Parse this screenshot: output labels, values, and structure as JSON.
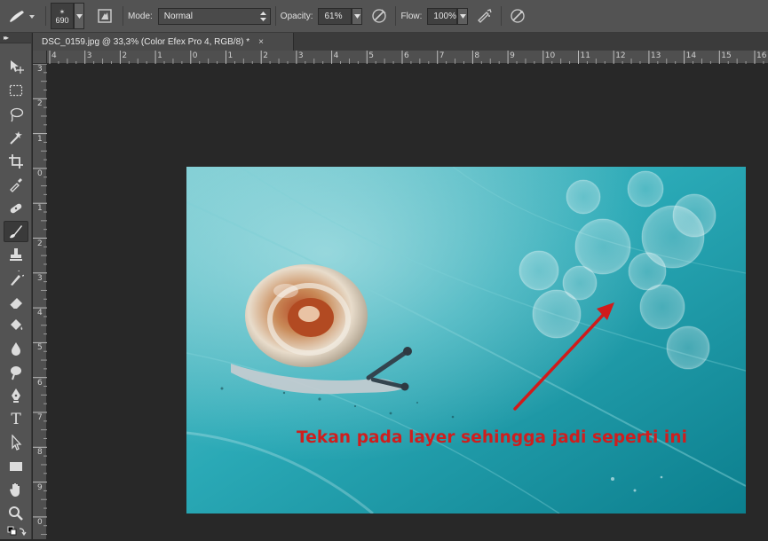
{
  "options_bar": {
    "brush_size": "690",
    "mode_label": "Mode:",
    "mode_value": "Normal",
    "opacity_label": "Opacity:",
    "opacity_value": "61%",
    "flow_label": "Flow:",
    "flow_value": "100%"
  },
  "document_tab": {
    "title": "DSC_0159.jpg @ 33,3% (Color Efex Pro 4, RGB/8) *",
    "close": "×"
  },
  "ruler_h": [
    "4",
    "3",
    "2",
    "1",
    "0",
    "1",
    "2",
    "3",
    "4",
    "5",
    "6",
    "7",
    "8",
    "9",
    "10",
    "11",
    "12",
    "13",
    "14",
    "15",
    "16"
  ],
  "ruler_v": [
    "3",
    "2",
    "1",
    "0",
    "1",
    "2",
    "3",
    "4",
    "5",
    "6",
    "7",
    "8",
    "9",
    "0"
  ],
  "annotation": {
    "text": "Tekan pada layer sehingga jadi seperti ini",
    "color": "#cf1e1e"
  },
  "toolbar": {
    "tools": [
      "move-tool",
      "marquee-tool",
      "lasso-tool",
      "magic-wand-tool",
      "crop-tool",
      "eyedropper-tool",
      "healing-brush-tool",
      "brush-tool",
      "clone-stamp-tool",
      "history-brush-tool",
      "eraser-tool",
      "paint-bucket-tool",
      "blur-tool",
      "dodge-tool",
      "pen-tool",
      "type-tool",
      "path-selection-tool",
      "rectangle-tool",
      "hand-tool",
      "zoom-tool"
    ],
    "active_tool": "brush-tool"
  },
  "colors": {
    "panel": "#535353",
    "workspace": "#282828",
    "photo_teal": "#2aa9b6"
  }
}
